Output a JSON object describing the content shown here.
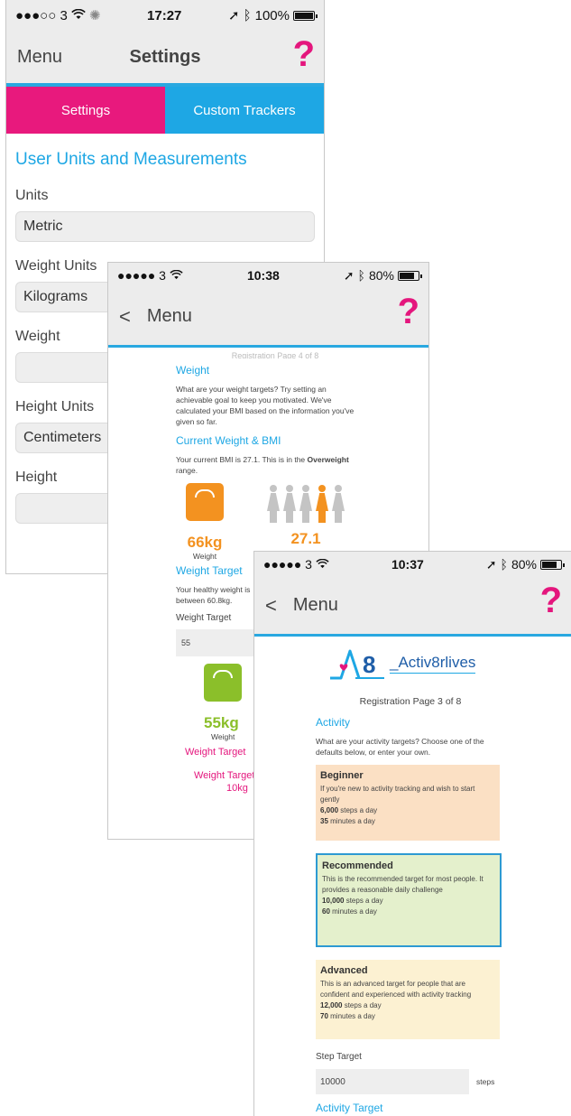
{
  "colors": {
    "accent_blue": "#1ea7e4",
    "accent_pink": "#e8197d",
    "orange": "#f39220",
    "green": "#8bbf2a"
  },
  "screen1": {
    "status": {
      "signal": "●●●○○ 3",
      "time": "17:27",
      "battery": "100%"
    },
    "nav": {
      "menu": "Menu",
      "title": "Settings",
      "help": "?"
    },
    "tabs": [
      {
        "label": "Settings"
      },
      {
        "label": "Custom Trackers"
      }
    ],
    "section_title": "User Units and Measurements",
    "fields": [
      {
        "label": "Units",
        "value": "Metric"
      },
      {
        "label": "Weight Units",
        "value": "Kilograms"
      },
      {
        "label": "Weight",
        "value": ""
      },
      {
        "label": "Height Units",
        "value": "Centimeters"
      },
      {
        "label": "Height",
        "value": ""
      }
    ]
  },
  "screen2": {
    "status": {
      "signal": "●●●●● 3",
      "time": "10:38",
      "battery": "80%"
    },
    "nav": {
      "back": "<",
      "menu": "Menu",
      "help": "?"
    },
    "faded_header": "Registration Page 4 of 8",
    "weight_title": "Weight",
    "weight_intro": "What are your weight targets? Try setting an achievable goal to keep you motivated. We've calculated your BMI based on the information you've given so far.",
    "current_title": "Current Weight & BMI",
    "bmi_text_prefix": "Your current BMI is 27.1. This is in the ",
    "bmi_range": "Overweight",
    "bmi_text_suffix": " range.",
    "current_weight": "66kg",
    "weight_caption": "Weight",
    "bmi_value": "27.1",
    "bmi_level": 4,
    "bmi_scale_count": 5,
    "target_title": "Weight Target",
    "healthy_text": "Your healthy weight is between 60.8kg.",
    "target_label": "Weight Target",
    "target_value": "55",
    "target_weight": "55kg",
    "target_caption": "Weight",
    "pink_target": "Weight Target",
    "pink_target2": "Weight Target",
    "pink_loss": "10kg"
  },
  "screen3": {
    "status": {
      "signal": "●●●●● 3",
      "time": "10:37",
      "battery": "80%"
    },
    "nav": {
      "back": "<",
      "menu": "Menu",
      "help": "?"
    },
    "logo_text": "A8",
    "brand": "_Activ8rlives",
    "reg_page": "Registration Page 3 of 8",
    "activity_title": "Activity",
    "activity_intro": "What are your activity targets? Choose one of the defaults below, or enter your own.",
    "cards": [
      {
        "title": "Beginner",
        "desc": "If you're new to activity tracking and wish to start gently",
        "steps": "6,000",
        "steps_suffix": " steps a day",
        "minutes": "35",
        "minutes_suffix": " minutes a day"
      },
      {
        "title": "Recommended",
        "desc": "This is the recommended target for most people. It provides a reasonable daily challenge",
        "steps": "10,000",
        "steps_suffix": " steps a day",
        "minutes": "60",
        "minutes_suffix": " minutes a day"
      },
      {
        "title": "Advanced",
        "desc": "This is an advanced target for people that are confident and experienced with activity tracking",
        "steps": "12,000",
        "steps_suffix": " steps a day",
        "minutes": "70",
        "minutes_suffix": " minutes a day"
      }
    ],
    "step_target_label": "Step Target",
    "step_target_value": "10000",
    "steps_unit": "steps",
    "activity_target_title": "Activity Target"
  }
}
